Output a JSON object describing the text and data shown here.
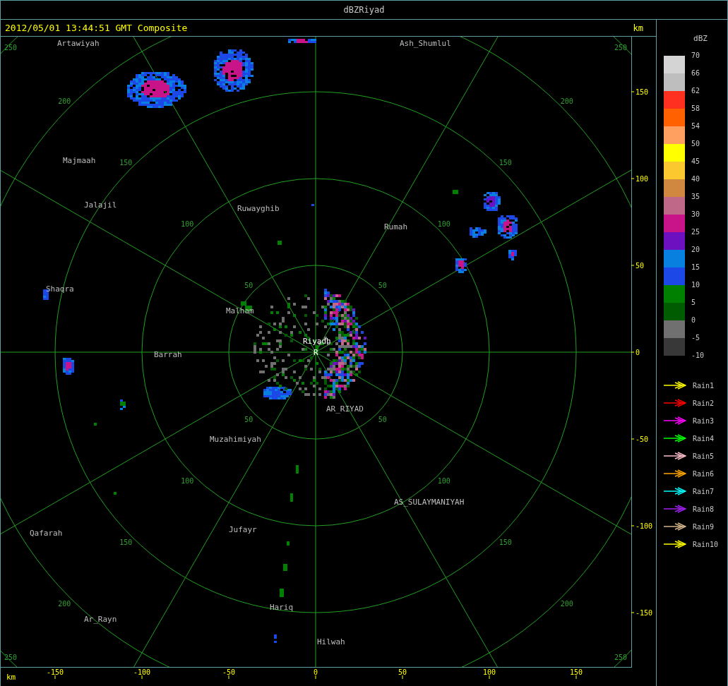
{
  "window": {
    "title": "dBZRiyad"
  },
  "header": {
    "timestamp": "2012/05/01 13:44:51 GMT Composite",
    "unit": "km"
  },
  "map": {
    "range_rings": [
      {
        "labels": [
          "50",
          "50",
          "50",
          "50"
        ]
      },
      {
        "labels": [
          "100",
          "100",
          "100",
          "100"
        ]
      },
      {
        "labels": [
          "150",
          "150",
          "150",
          "150"
        ]
      },
      {
        "labels": [
          "200",
          "200",
          "200",
          "200"
        ]
      },
      {
        "labels": [
          "250",
          "250",
          "250",
          "250"
        ]
      }
    ],
    "places": [
      {
        "name": "Artawiyah",
        "kind": "city"
      },
      {
        "name": "Ash_Shumlul",
        "kind": "city"
      },
      {
        "name": "Majmaah",
        "kind": "city"
      },
      {
        "name": "Jalajil",
        "kind": "city"
      },
      {
        "name": "Ruwayghib",
        "kind": "city"
      },
      {
        "name": "Rumah",
        "kind": "city"
      },
      {
        "name": "Shaqra",
        "kind": "city"
      },
      {
        "name": "Malham",
        "kind": "city"
      },
      {
        "name": "Riyadh",
        "kind": "radar"
      },
      {
        "name": "R",
        "kind": "radar"
      },
      {
        "name": "Barrah",
        "kind": "city"
      },
      {
        "name": "AR_RIYAD",
        "kind": "city"
      },
      {
        "name": "Muzahimiyah",
        "kind": "city"
      },
      {
        "name": "AS_SULAYMANIYAH",
        "kind": "city"
      },
      {
        "name": "Qafarah",
        "kind": "city"
      },
      {
        "name": "Jufayr",
        "kind": "city"
      },
      {
        "name": "Hariq",
        "kind": "city"
      },
      {
        "name": "Ar_Rayn",
        "kind": "city"
      },
      {
        "name": "Hilwah",
        "kind": "city"
      }
    ]
  },
  "y_axis": {
    "ticks": [
      "150",
      "100",
      "50",
      "0",
      "-50",
      "-100",
      "-150"
    ]
  },
  "x_axis": {
    "unit": "km",
    "ticks": [
      "-150",
      "-100",
      "-50",
      "0",
      "50",
      "100",
      "150"
    ]
  },
  "legend": {
    "title": "dBZ",
    "bins": [
      {
        "color": "#d4d4d4"
      },
      {
        "color": "#bebebe"
      },
      {
        "color": "#ff3020"
      },
      {
        "color": "#ff6000"
      },
      {
        "color": "#ffa060"
      },
      {
        "color": "#ffff00"
      },
      {
        "color": "#fcc830"
      },
      {
        "color": "#d08840"
      },
      {
        "color": "#c06888"
      },
      {
        "color": "#c81488"
      },
      {
        "color": "#6c10c0"
      },
      {
        "color": "#0880e0"
      },
      {
        "color": "#1c48e8"
      },
      {
        "color": "#008000"
      },
      {
        "color": "#005c00"
      },
      {
        "color": "#707070"
      },
      {
        "color": "#383838"
      }
    ],
    "labels": [
      "70",
      "66",
      "62",
      "58",
      "54",
      "50",
      "45",
      "40",
      "35",
      "30",
      "25",
      "20",
      "15",
      "10",
      "5",
      "0",
      "-5",
      "-10"
    ],
    "tracks": [
      {
        "name": "Rain1",
        "color": "#ffff00"
      },
      {
        "name": "Rain2",
        "color": "#ff0000"
      },
      {
        "name": "Rain3",
        "color": "#ff00ff"
      },
      {
        "name": "Rain4",
        "color": "#00ff00"
      },
      {
        "name": "Rain5",
        "color": "#ffc0cb"
      },
      {
        "name": "Rain6",
        "color": "#ffa500"
      },
      {
        "name": "Rain7",
        "color": "#00ffff"
      },
      {
        "name": "Rain8",
        "color": "#a020f0"
      },
      {
        "name": "Rain9",
        "color": "#d2b48c"
      },
      {
        "name": "Rain10",
        "color": "#ffff00"
      }
    ]
  }
}
